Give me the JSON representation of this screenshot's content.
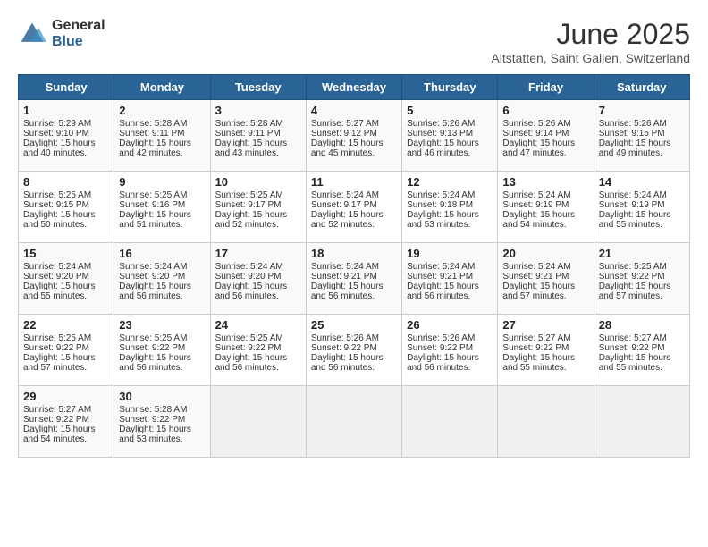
{
  "header": {
    "logo_general": "General",
    "logo_blue": "Blue",
    "title": "June 2025",
    "subtitle": "Altstatten, Saint Gallen, Switzerland"
  },
  "days_of_week": [
    "Sunday",
    "Monday",
    "Tuesday",
    "Wednesday",
    "Thursday",
    "Friday",
    "Saturday"
  ],
  "weeks": [
    [
      {
        "day": "1",
        "lines": [
          "Sunrise: 5:29 AM",
          "Sunset: 9:10 PM",
          "Daylight: 15 hours",
          "and 40 minutes."
        ]
      },
      {
        "day": "2",
        "lines": [
          "Sunrise: 5:28 AM",
          "Sunset: 9:11 PM",
          "Daylight: 15 hours",
          "and 42 minutes."
        ]
      },
      {
        "day": "3",
        "lines": [
          "Sunrise: 5:28 AM",
          "Sunset: 9:11 PM",
          "Daylight: 15 hours",
          "and 43 minutes."
        ]
      },
      {
        "day": "4",
        "lines": [
          "Sunrise: 5:27 AM",
          "Sunset: 9:12 PM",
          "Daylight: 15 hours",
          "and 45 minutes."
        ]
      },
      {
        "day": "5",
        "lines": [
          "Sunrise: 5:26 AM",
          "Sunset: 9:13 PM",
          "Daylight: 15 hours",
          "and 46 minutes."
        ]
      },
      {
        "day": "6",
        "lines": [
          "Sunrise: 5:26 AM",
          "Sunset: 9:14 PM",
          "Daylight: 15 hours",
          "and 47 minutes."
        ]
      },
      {
        "day": "7",
        "lines": [
          "Sunrise: 5:26 AM",
          "Sunset: 9:15 PM",
          "Daylight: 15 hours",
          "and 49 minutes."
        ]
      }
    ],
    [
      {
        "day": "8",
        "lines": [
          "Sunrise: 5:25 AM",
          "Sunset: 9:15 PM",
          "Daylight: 15 hours",
          "and 50 minutes."
        ]
      },
      {
        "day": "9",
        "lines": [
          "Sunrise: 5:25 AM",
          "Sunset: 9:16 PM",
          "Daylight: 15 hours",
          "and 51 minutes."
        ]
      },
      {
        "day": "10",
        "lines": [
          "Sunrise: 5:25 AM",
          "Sunset: 9:17 PM",
          "Daylight: 15 hours",
          "and 52 minutes."
        ]
      },
      {
        "day": "11",
        "lines": [
          "Sunrise: 5:24 AM",
          "Sunset: 9:17 PM",
          "Daylight: 15 hours",
          "and 52 minutes."
        ]
      },
      {
        "day": "12",
        "lines": [
          "Sunrise: 5:24 AM",
          "Sunset: 9:18 PM",
          "Daylight: 15 hours",
          "and 53 minutes."
        ]
      },
      {
        "day": "13",
        "lines": [
          "Sunrise: 5:24 AM",
          "Sunset: 9:19 PM",
          "Daylight: 15 hours",
          "and 54 minutes."
        ]
      },
      {
        "day": "14",
        "lines": [
          "Sunrise: 5:24 AM",
          "Sunset: 9:19 PM",
          "Daylight: 15 hours",
          "and 55 minutes."
        ]
      }
    ],
    [
      {
        "day": "15",
        "lines": [
          "Sunrise: 5:24 AM",
          "Sunset: 9:20 PM",
          "Daylight: 15 hours",
          "and 55 minutes."
        ]
      },
      {
        "day": "16",
        "lines": [
          "Sunrise: 5:24 AM",
          "Sunset: 9:20 PM",
          "Daylight: 15 hours",
          "and 56 minutes."
        ]
      },
      {
        "day": "17",
        "lines": [
          "Sunrise: 5:24 AM",
          "Sunset: 9:20 PM",
          "Daylight: 15 hours",
          "and 56 minutes."
        ]
      },
      {
        "day": "18",
        "lines": [
          "Sunrise: 5:24 AM",
          "Sunset: 9:21 PM",
          "Daylight: 15 hours",
          "and 56 minutes."
        ]
      },
      {
        "day": "19",
        "lines": [
          "Sunrise: 5:24 AM",
          "Sunset: 9:21 PM",
          "Daylight: 15 hours",
          "and 56 minutes."
        ]
      },
      {
        "day": "20",
        "lines": [
          "Sunrise: 5:24 AM",
          "Sunset: 9:21 PM",
          "Daylight: 15 hours",
          "and 57 minutes."
        ]
      },
      {
        "day": "21",
        "lines": [
          "Sunrise: 5:25 AM",
          "Sunset: 9:22 PM",
          "Daylight: 15 hours",
          "and 57 minutes."
        ]
      }
    ],
    [
      {
        "day": "22",
        "lines": [
          "Sunrise: 5:25 AM",
          "Sunset: 9:22 PM",
          "Daylight: 15 hours",
          "and 57 minutes."
        ]
      },
      {
        "day": "23",
        "lines": [
          "Sunrise: 5:25 AM",
          "Sunset: 9:22 PM",
          "Daylight: 15 hours",
          "and 56 minutes."
        ]
      },
      {
        "day": "24",
        "lines": [
          "Sunrise: 5:25 AM",
          "Sunset: 9:22 PM",
          "Daylight: 15 hours",
          "and 56 minutes."
        ]
      },
      {
        "day": "25",
        "lines": [
          "Sunrise: 5:26 AM",
          "Sunset: 9:22 PM",
          "Daylight: 15 hours",
          "and 56 minutes."
        ]
      },
      {
        "day": "26",
        "lines": [
          "Sunrise: 5:26 AM",
          "Sunset: 9:22 PM",
          "Daylight: 15 hours",
          "and 56 minutes."
        ]
      },
      {
        "day": "27",
        "lines": [
          "Sunrise: 5:27 AM",
          "Sunset: 9:22 PM",
          "Daylight: 15 hours",
          "and 55 minutes."
        ]
      },
      {
        "day": "28",
        "lines": [
          "Sunrise: 5:27 AM",
          "Sunset: 9:22 PM",
          "Daylight: 15 hours",
          "and 55 minutes."
        ]
      }
    ],
    [
      {
        "day": "29",
        "lines": [
          "Sunrise: 5:27 AM",
          "Sunset: 9:22 PM",
          "Daylight: 15 hours",
          "and 54 minutes."
        ]
      },
      {
        "day": "30",
        "lines": [
          "Sunrise: 5:28 AM",
          "Sunset: 9:22 PM",
          "Daylight: 15 hours",
          "and 53 minutes."
        ]
      },
      {
        "day": "",
        "lines": []
      },
      {
        "day": "",
        "lines": []
      },
      {
        "day": "",
        "lines": []
      },
      {
        "day": "",
        "lines": []
      },
      {
        "day": "",
        "lines": []
      }
    ]
  ]
}
